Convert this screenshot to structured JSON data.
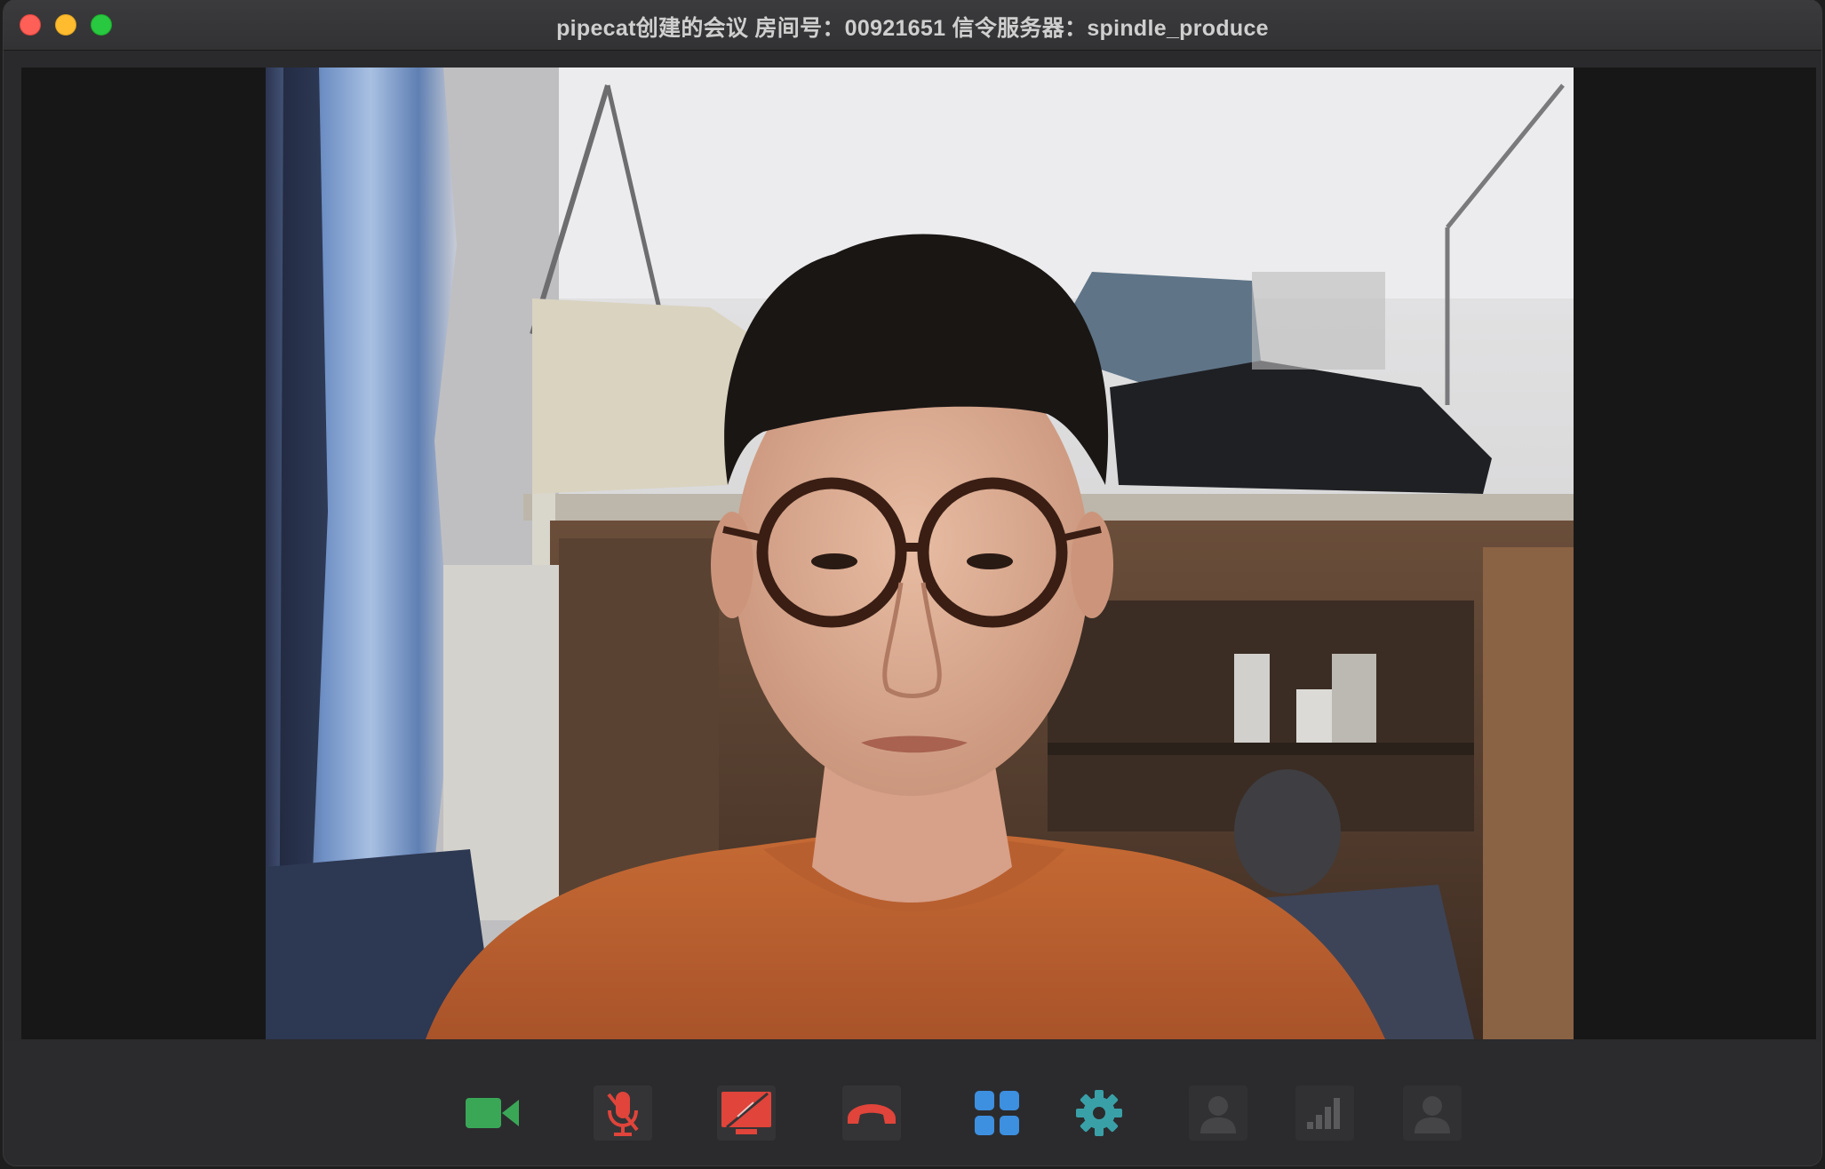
{
  "window": {
    "title": "pipecat创建的会议  房间号：00921651  信令服务器：spindle_produce"
  },
  "video": {
    "participant": "remote-camera-feed"
  },
  "toolbar": {
    "buttons": [
      {
        "name": "camera-button",
        "icon": "video-camera-icon",
        "color": "#3aa757",
        "state": "on"
      },
      {
        "name": "microphone-button",
        "icon": "microphone-muted-icon",
        "color": "#e0443a",
        "state": "muted"
      },
      {
        "name": "screen-share-button",
        "icon": "screen-share-off-icon",
        "color": "#e0443a",
        "state": "off"
      },
      {
        "name": "hang-up-button",
        "icon": "hang-up-icon",
        "color": "#e0443a",
        "state": "active"
      },
      {
        "name": "layout-button",
        "icon": "grid-icon",
        "color": "#3d8fe0",
        "state": "active"
      },
      {
        "name": "settings-button",
        "icon": "gear-icon",
        "color": "#3aa0a8",
        "state": "active"
      },
      {
        "name": "participants-button",
        "icon": "person-icon",
        "color": "#4a4a4c",
        "state": "disabled"
      },
      {
        "name": "network-stats-button",
        "icon": "signal-bars-icon",
        "color": "#4a4a4c",
        "state": "disabled"
      },
      {
        "name": "user-info-button",
        "icon": "person-icon",
        "color": "#4a4a4c",
        "state": "disabled"
      }
    ]
  }
}
